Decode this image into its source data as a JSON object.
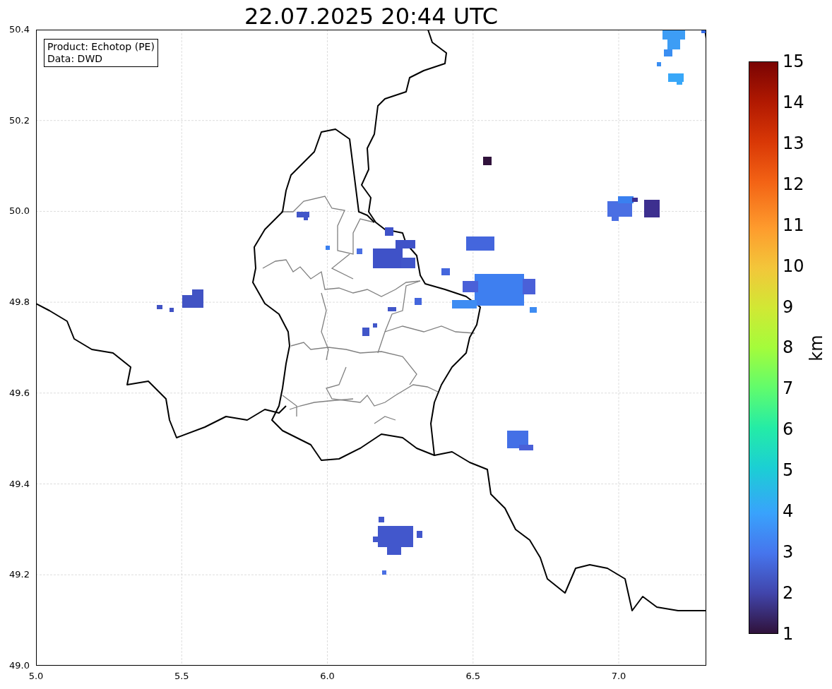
{
  "title": "22.07.2025 20:44 UTC",
  "info_box": {
    "lines": [
      "Product: Echotop (PE)",
      "Data: DWD"
    ]
  },
  "map": {
    "x_ticks": [
      "5.0",
      "5.5",
      "6.0",
      "6.5",
      "7.0"
    ],
    "y_ticks": [
      "50.4",
      "50.2",
      "50.0",
      "49.8",
      "49.6",
      "49.4",
      "49.2",
      "49.0"
    ]
  },
  "colorbar": {
    "ticks": [
      "15",
      "14",
      "13",
      "12",
      "11",
      "10",
      "9",
      "8",
      "7",
      "6",
      "5",
      "4",
      "3",
      "2",
      "1"
    ],
    "label": "km"
  }
}
